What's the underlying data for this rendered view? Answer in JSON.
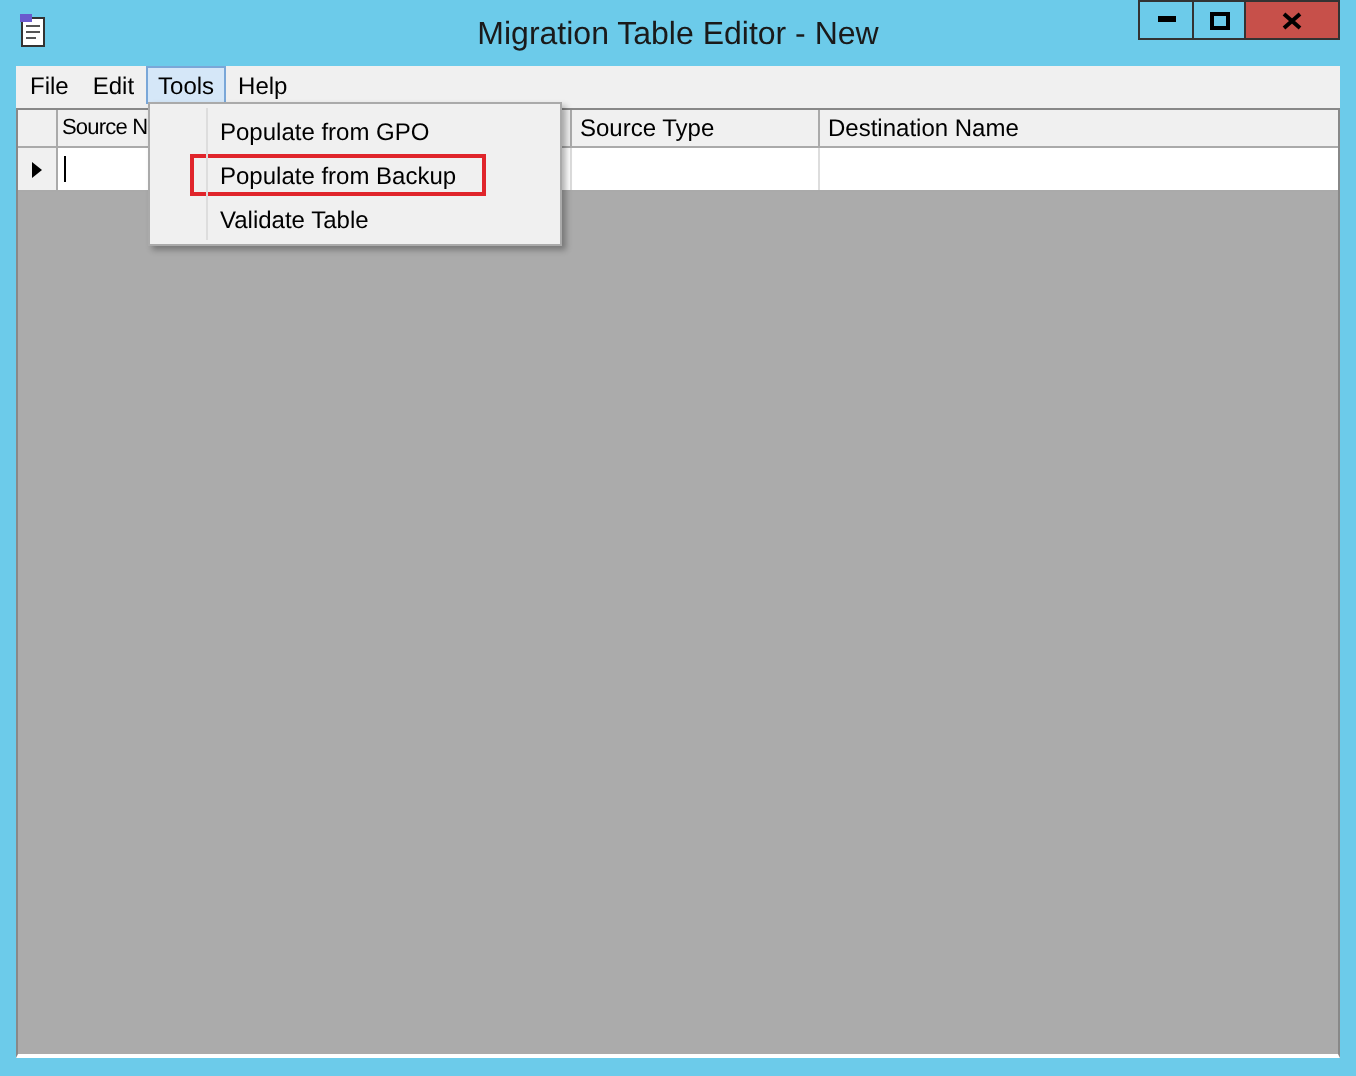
{
  "window": {
    "title": "Migration Table Editor - New"
  },
  "menu": [
    {
      "label": "File",
      "selected": false
    },
    {
      "label": "Edit",
      "selected": false
    },
    {
      "label": "Tools",
      "selected": true
    },
    {
      "label": "Help",
      "selected": false
    }
  ],
  "dropdown": {
    "items": [
      {
        "label": "Populate from GPO",
        "annotated": false
      },
      {
        "label": "Populate from Backup",
        "annotated": true
      },
      {
        "label": "Validate Table",
        "annotated": false
      }
    ]
  },
  "table": {
    "columns": [
      "Source N",
      "Source Type",
      "Destination Name"
    ],
    "rows": [
      {
        "current": true,
        "editing": true
      }
    ]
  }
}
